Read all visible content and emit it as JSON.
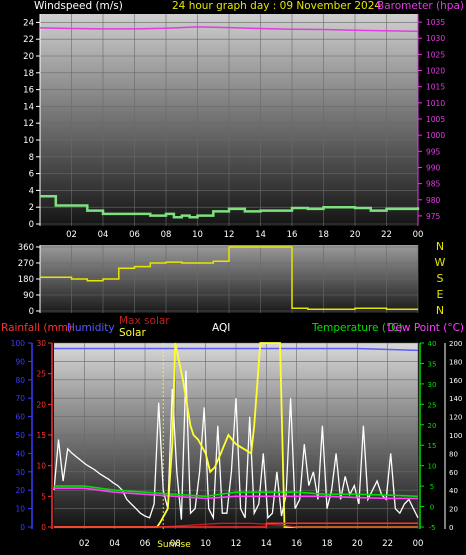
{
  "header": {
    "windspeed_label": "Windspeed (m/s)",
    "title": "24 hour graph day : 09 November 2024",
    "barometer_label": "Barometer (hpa)"
  },
  "colors": {
    "wind": "#7fe07f",
    "barometer": "#e23ce2",
    "winddir": "#e6e600",
    "rain": "#ff3030",
    "humidity": "#5a5aff",
    "temperature": "#00e000",
    "dewpoint": "#ff40ff",
    "solar": "#ffff30",
    "maxsolar": "#c02020",
    "aqi": "#ffffff",
    "axis_left": "#3a3aff"
  },
  "compass_letters": [
    "N",
    "W",
    "S",
    "E",
    "N"
  ],
  "bottom_legend": {
    "rainfall": "Rainfall (mm)",
    "humidity": "Humidity",
    "maxsolar": "Max solar",
    "solar": "Solar",
    "aqi": "AQI",
    "temperature": "Temperature (°C)",
    "dewpoint": "Dew Point (°C)"
  },
  "sunrise_label": "Sunrise",
  "chart_data": [
    {
      "type": "line",
      "title": "24 hour graph day : 09 November 2024",
      "x_ticks": [
        "02",
        "04",
        "06",
        "08",
        "10",
        "12",
        "14",
        "16",
        "18",
        "20",
        "22",
        "00"
      ],
      "y_left_label": "Windspeed (m/s)",
      "y_left_ticks": [
        0,
        2,
        4,
        6,
        8,
        10,
        12,
        14,
        16,
        18,
        20,
        22,
        24
      ],
      "ylim_left": [
        0,
        25
      ],
      "y_right_label": "Barometer (hpa)",
      "y_right_ticks": [
        975,
        980,
        985,
        990,
        995,
        1000,
        1005,
        1010,
        1015,
        1020,
        1025,
        1030,
        1035
      ],
      "ylim_right": [
        972.5,
        1037.5
      ],
      "series": [
        {
          "name": "Windspeed (m/s)",
          "axis": "left",
          "x": [
            0,
            1,
            2,
            3,
            4,
            5,
            6,
            7,
            8,
            8.5,
            9,
            9.5,
            10,
            11,
            12,
            13,
            14,
            15,
            16,
            17,
            18,
            19,
            20,
            21,
            22,
            23,
            24
          ],
          "y": [
            3.3,
            2.2,
            2.2,
            1.6,
            1.2,
            1.2,
            1.2,
            1.0,
            1.2,
            0.8,
            1.0,
            0.8,
            1.0,
            1.5,
            1.8,
            1.5,
            1.6,
            1.6,
            1.9,
            1.8,
            2.0,
            2.0,
            1.9,
            1.6,
            1.8,
            1.8,
            2.0
          ]
        },
        {
          "name": "Barometer (hpa)",
          "axis": "right",
          "x": [
            0,
            2,
            4,
            6,
            8,
            10,
            12,
            14,
            16,
            18,
            20,
            22,
            24
          ],
          "y": [
            1033.2,
            1033.0,
            1032.9,
            1032.9,
            1033.1,
            1033.5,
            1033.3,
            1033.0,
            1032.8,
            1032.7,
            1032.5,
            1032.3,
            1032.1
          ]
        }
      ]
    },
    {
      "type": "line",
      "y_ticks": [
        0,
        90,
        180,
        270,
        360
      ],
      "ylim": [
        0,
        360
      ],
      "compass": [
        "N",
        "W",
        "S",
        "E",
        "N"
      ],
      "series": [
        {
          "name": "Wind direction",
          "x": [
            0,
            1,
            2,
            3,
            4,
            5,
            6,
            7,
            8,
            9,
            10,
            11,
            12,
            13,
            14,
            15,
            16,
            17,
            18,
            19,
            20,
            21,
            22,
            23,
            24
          ],
          "y": [
            190,
            190,
            180,
            170,
            180,
            240,
            250,
            270,
            275,
            270,
            270,
            280,
            360,
            360,
            360,
            360,
            15,
            10,
            10,
            10,
            15,
            15,
            10,
            10,
            10
          ]
        }
      ]
    },
    {
      "type": "line",
      "x_ticks": [
        "02",
        "04",
        "06",
        "08",
        "10",
        "12",
        "14",
        "16",
        "18",
        "20",
        "22",
        "00"
      ],
      "y_left_ticks": [
        0,
        10,
        20,
        30,
        40,
        50,
        60,
        70,
        80,
        90,
        100
      ],
      "y_rain_ticks": [
        0,
        5,
        10,
        15,
        20,
        25,
        30
      ],
      "y_temp_ticks": [
        -5,
        0,
        5,
        10,
        15,
        20,
        25,
        30,
        35,
        40
      ],
      "y_solar_ticks": [
        0,
        20,
        40,
        60,
        80,
        100,
        120,
        140,
        160,
        180,
        200
      ],
      "series": [
        {
          "name": "Humidity",
          "axis": "left",
          "x": [
            0,
            4,
            8,
            12,
            16,
            20,
            24
          ],
          "y": [
            97,
            97,
            97,
            97,
            97,
            97,
            96
          ]
        },
        {
          "name": "Temperature (°C)",
          "axis": "temp",
          "x": [
            0,
            2,
            4,
            6,
            8,
            10,
            12,
            14,
            16,
            18,
            20,
            22,
            24
          ],
          "y": [
            5.0,
            5.0,
            4.0,
            3.5,
            3.0,
            2.5,
            3.5,
            3.5,
            3.5,
            3.0,
            3.0,
            2.8,
            2.5
          ]
        },
        {
          "name": "Dew Point (°C)",
          "axis": "temp",
          "x": [
            0,
            2,
            4,
            6,
            8,
            10,
            12,
            14,
            16,
            18,
            20,
            22,
            24
          ],
          "y": [
            4.5,
            4.5,
            3.5,
            3.0,
            2.5,
            2.0,
            2.5,
            2.5,
            2.5,
            2.5,
            2.2,
            2.0,
            2.0
          ]
        },
        {
          "name": "Solar",
          "axis": "solar",
          "x": [
            0,
            6.8,
            7,
            7.5,
            7.8,
            8,
            8.5,
            9.0,
            9.2,
            9.5,
            10,
            10.3,
            10.6,
            11,
            11.5,
            12,
            12.5,
            13.0,
            13.2,
            13.6,
            13.9,
            14.2,
            14.5,
            14.9,
            15.2,
            16,
            24
          ],
          "y": [
            0,
            0,
            5,
            20,
            90,
            200,
            160,
            110,
            100,
            95,
            80,
            60,
            65,
            80,
            100,
            90,
            85,
            80,
            110,
            200,
            200,
            200,
            200,
            200,
            0,
            0,
            0
          ]
        },
        {
          "name": "Max solar",
          "axis": "solar",
          "x": [
            0,
            7,
            8,
            9,
            10,
            11,
            12,
            13,
            14,
            15,
            16,
            24
          ],
          "y": [
            0,
            0,
            1,
            2,
            3,
            4,
            4,
            4,
            3,
            2,
            0,
            0
          ]
        },
        {
          "name": "Rainfall (mm)",
          "axis": "rain",
          "x": [
            0,
            13.5,
            14,
            24
          ],
          "y": [
            0,
            0,
            0.6,
            0.6
          ]
        },
        {
          "name": "AQI",
          "axis": "solar",
          "x": [
            0,
            0.3,
            0.6,
            0.9,
            1.2,
            1.5,
            1.8,
            2.1,
            2.4,
            2.7,
            3.0,
            3.3,
            3.6,
            3.9,
            4.2,
            4.5,
            4.8,
            5.1,
            5.4,
            5.7,
            6.0,
            6.3,
            6.6,
            6.9,
            7.2,
            7.5,
            7.8,
            8.1,
            8.4,
            8.7,
            9.0,
            9.3,
            9.6,
            9.9,
            10.2,
            10.5,
            10.8,
            11.1,
            11.4,
            11.7,
            12.0,
            12.3,
            12.6,
            12.9,
            13.2,
            13.5,
            13.8,
            14.1,
            14.4,
            14.7,
            15.0,
            15.3,
            15.6,
            15.9,
            16.2,
            16.5,
            16.8,
            17.1,
            17.4,
            17.7,
            18.0,
            18.3,
            18.6,
            18.9,
            19.2,
            19.5,
            19.8,
            20.1,
            20.4,
            20.7,
            21.0,
            21.3,
            21.6,
            21.9,
            22.2,
            22.5,
            22.8,
            23.1,
            23.4,
            23.7,
            24.0
          ],
          "y": [
            40,
            95,
            50,
            85,
            80,
            76,
            72,
            68,
            65,
            62,
            58,
            55,
            52,
            48,
            45,
            40,
            30,
            25,
            20,
            15,
            12,
            10,
            25,
            135,
            40,
            20,
            150,
            60,
            8,
            170,
            15,
            20,
            60,
            130,
            20,
            10,
            110,
            15,
            15,
            60,
            140,
            20,
            10,
            120,
            15,
            25,
            80,
            10,
            15,
            60,
            12,
            35,
            140,
            20,
            30,
            90,
            45,
            60,
            30,
            110,
            20,
            40,
            80,
            30,
            55,
            35,
            45,
            25,
            110,
            30,
            40,
            50,
            35,
            30,
            80,
            20,
            15,
            25,
            30,
            20,
            10
          ]
        }
      ]
    }
  ]
}
